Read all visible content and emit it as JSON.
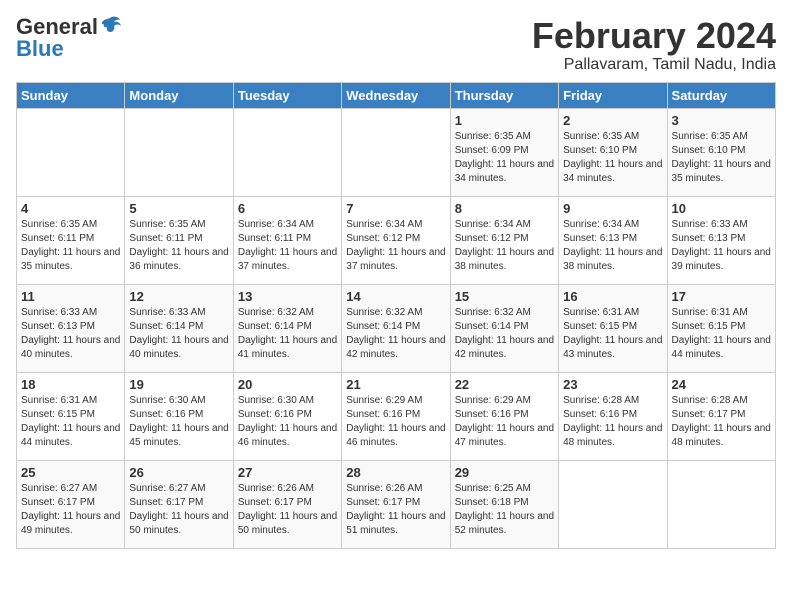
{
  "logo": {
    "general": "General",
    "blue": "Blue"
  },
  "title": {
    "month_year": "February 2024",
    "location": "Pallavaram, Tamil Nadu, India"
  },
  "weekdays": [
    "Sunday",
    "Monday",
    "Tuesday",
    "Wednesday",
    "Thursday",
    "Friday",
    "Saturday"
  ],
  "weeks": [
    [
      {
        "day": "",
        "info": ""
      },
      {
        "day": "",
        "info": ""
      },
      {
        "day": "",
        "info": ""
      },
      {
        "day": "",
        "info": ""
      },
      {
        "day": "1",
        "info": "Sunrise: 6:35 AM\nSunset: 6:09 PM\nDaylight: 11 hours and 34 minutes."
      },
      {
        "day": "2",
        "info": "Sunrise: 6:35 AM\nSunset: 6:10 PM\nDaylight: 11 hours and 34 minutes."
      },
      {
        "day": "3",
        "info": "Sunrise: 6:35 AM\nSunset: 6:10 PM\nDaylight: 11 hours and 35 minutes."
      }
    ],
    [
      {
        "day": "4",
        "info": "Sunrise: 6:35 AM\nSunset: 6:11 PM\nDaylight: 11 hours and 35 minutes."
      },
      {
        "day": "5",
        "info": "Sunrise: 6:35 AM\nSunset: 6:11 PM\nDaylight: 11 hours and 36 minutes."
      },
      {
        "day": "6",
        "info": "Sunrise: 6:34 AM\nSunset: 6:11 PM\nDaylight: 11 hours and 37 minutes."
      },
      {
        "day": "7",
        "info": "Sunrise: 6:34 AM\nSunset: 6:12 PM\nDaylight: 11 hours and 37 minutes."
      },
      {
        "day": "8",
        "info": "Sunrise: 6:34 AM\nSunset: 6:12 PM\nDaylight: 11 hours and 38 minutes."
      },
      {
        "day": "9",
        "info": "Sunrise: 6:34 AM\nSunset: 6:13 PM\nDaylight: 11 hours and 38 minutes."
      },
      {
        "day": "10",
        "info": "Sunrise: 6:33 AM\nSunset: 6:13 PM\nDaylight: 11 hours and 39 minutes."
      }
    ],
    [
      {
        "day": "11",
        "info": "Sunrise: 6:33 AM\nSunset: 6:13 PM\nDaylight: 11 hours and 40 minutes."
      },
      {
        "day": "12",
        "info": "Sunrise: 6:33 AM\nSunset: 6:14 PM\nDaylight: 11 hours and 40 minutes."
      },
      {
        "day": "13",
        "info": "Sunrise: 6:32 AM\nSunset: 6:14 PM\nDaylight: 11 hours and 41 minutes."
      },
      {
        "day": "14",
        "info": "Sunrise: 6:32 AM\nSunset: 6:14 PM\nDaylight: 11 hours and 42 minutes."
      },
      {
        "day": "15",
        "info": "Sunrise: 6:32 AM\nSunset: 6:14 PM\nDaylight: 11 hours and 42 minutes."
      },
      {
        "day": "16",
        "info": "Sunrise: 6:31 AM\nSunset: 6:15 PM\nDaylight: 11 hours and 43 minutes."
      },
      {
        "day": "17",
        "info": "Sunrise: 6:31 AM\nSunset: 6:15 PM\nDaylight: 11 hours and 44 minutes."
      }
    ],
    [
      {
        "day": "18",
        "info": "Sunrise: 6:31 AM\nSunset: 6:15 PM\nDaylight: 11 hours and 44 minutes."
      },
      {
        "day": "19",
        "info": "Sunrise: 6:30 AM\nSunset: 6:16 PM\nDaylight: 11 hours and 45 minutes."
      },
      {
        "day": "20",
        "info": "Sunrise: 6:30 AM\nSunset: 6:16 PM\nDaylight: 11 hours and 46 minutes."
      },
      {
        "day": "21",
        "info": "Sunrise: 6:29 AM\nSunset: 6:16 PM\nDaylight: 11 hours and 46 minutes."
      },
      {
        "day": "22",
        "info": "Sunrise: 6:29 AM\nSunset: 6:16 PM\nDaylight: 11 hours and 47 minutes."
      },
      {
        "day": "23",
        "info": "Sunrise: 6:28 AM\nSunset: 6:16 PM\nDaylight: 11 hours and 48 minutes."
      },
      {
        "day": "24",
        "info": "Sunrise: 6:28 AM\nSunset: 6:17 PM\nDaylight: 11 hours and 48 minutes."
      }
    ],
    [
      {
        "day": "25",
        "info": "Sunrise: 6:27 AM\nSunset: 6:17 PM\nDaylight: 11 hours and 49 minutes."
      },
      {
        "day": "26",
        "info": "Sunrise: 6:27 AM\nSunset: 6:17 PM\nDaylight: 11 hours and 50 minutes."
      },
      {
        "day": "27",
        "info": "Sunrise: 6:26 AM\nSunset: 6:17 PM\nDaylight: 11 hours and 50 minutes."
      },
      {
        "day": "28",
        "info": "Sunrise: 6:26 AM\nSunset: 6:17 PM\nDaylight: 11 hours and 51 minutes."
      },
      {
        "day": "29",
        "info": "Sunrise: 6:25 AM\nSunset: 6:18 PM\nDaylight: 11 hours and 52 minutes."
      },
      {
        "day": "",
        "info": ""
      },
      {
        "day": "",
        "info": ""
      }
    ]
  ]
}
